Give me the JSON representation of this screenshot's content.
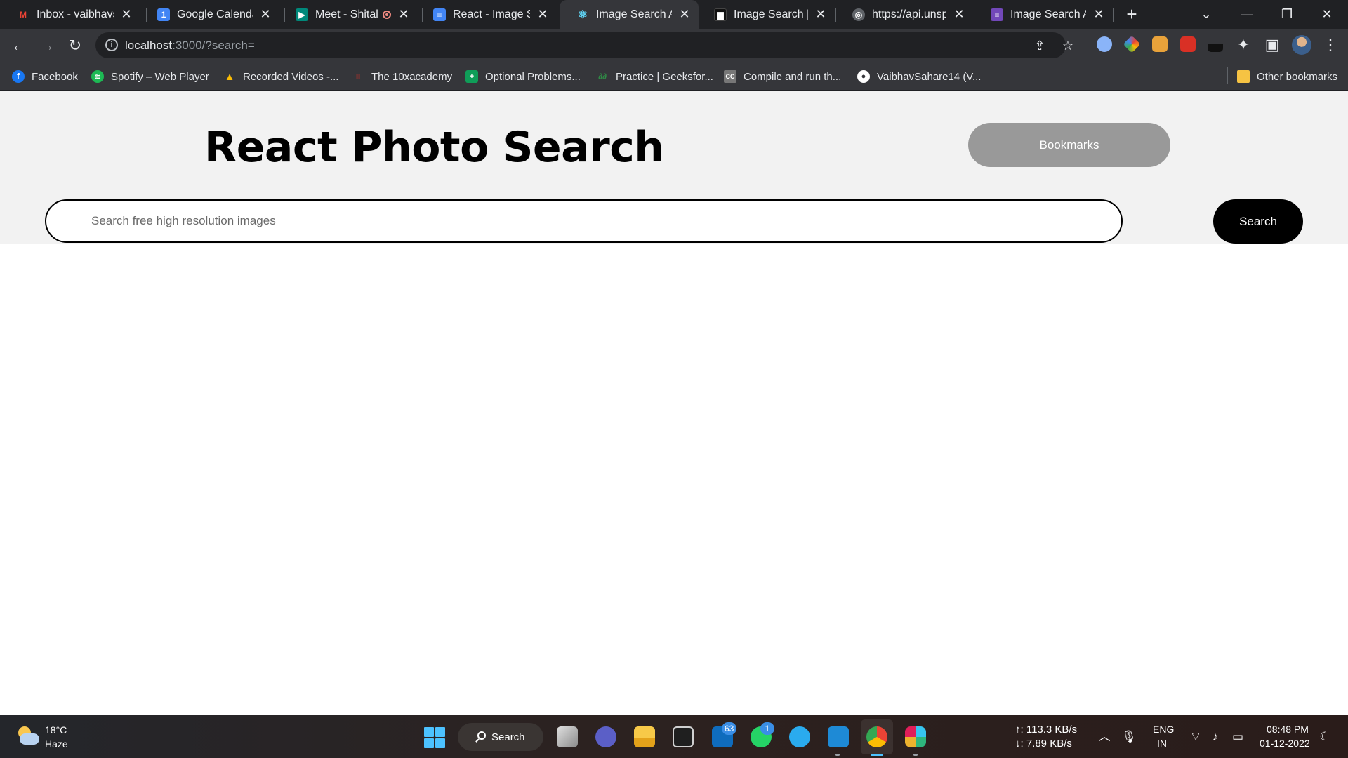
{
  "browser": {
    "tabs": [
      {
        "title": "Inbox - vaibhavsa",
        "favicon_color": "#ea4335",
        "favicon_glyph": "M",
        "active": false
      },
      {
        "title": "Google Calendar",
        "favicon_color": "#4285f4",
        "favicon_glyph": "1",
        "active": false
      },
      {
        "title": "Meet - Shital",
        "favicon_color": "#00897b",
        "favicon_glyph": "▶",
        "active": false,
        "recording": true
      },
      {
        "title": "React - Image Sea",
        "favicon_color": "#4285f4",
        "favicon_glyph": "≡",
        "active": false
      },
      {
        "title": "Image Search Ap",
        "favicon_color": "#61dafb",
        "favicon_glyph": "⚛",
        "active": true
      },
      {
        "title": "Image Search | U",
        "favicon_color": "#111111",
        "favicon_glyph": "▆",
        "active": false
      },
      {
        "title": "https://api.unspla",
        "favicon_color": "#5f6368",
        "favicon_glyph": "◎",
        "active": false
      },
      {
        "title": "Image Search Ap",
        "favicon_color": "#7248b9",
        "favicon_glyph": "≡",
        "active": false
      }
    ],
    "address": {
      "host": "localhost",
      "rest": ":3000/?search="
    },
    "bookmarks": [
      {
        "label": "Facebook",
        "color": "#1877f2",
        "glyph": "f"
      },
      {
        "label": "Spotify – Web Player",
        "color": "#1db954",
        "glyph": "≋"
      },
      {
        "label": "Recorded Videos -...",
        "color": "#fbbc04",
        "glyph": "▲"
      },
      {
        "label": "The 10xacademy",
        "color": "#d93025",
        "glyph": "ıı"
      },
      {
        "label": "Optional Problems...",
        "color": "#0f9d58",
        "glyph": "+"
      },
      {
        "label": "Practice | Geeksfor...",
        "color": "#2f8d46",
        "glyph": "∂∂"
      },
      {
        "label": "Compile and run th...",
        "color": "#777777",
        "glyph": "CC"
      },
      {
        "label": "VaibhavSahare14 (V...",
        "color": "#ffffff",
        "glyph": "●"
      }
    ],
    "other_bookmarks": "Other bookmarks",
    "icons": {
      "back": "arrow-left-icon",
      "forward": "arrow-right-icon",
      "reload": "reload-icon",
      "share": "share-icon",
      "star": "star-icon",
      "extensions": "puzzle-icon",
      "sidepanel": "side-panel-icon"
    }
  },
  "app": {
    "title": "React Photo Search",
    "bookmarks_button": "Bookmarks",
    "search_placeholder": "Search free high resolution images",
    "search_value": "",
    "search_button": "Search",
    "colors": {
      "header_bg": "#f2f2f2",
      "bookmarks_btn": "#999999",
      "search_btn": "#000000"
    }
  },
  "taskbar": {
    "weather": {
      "temp": "18°C",
      "condition": "Haze"
    },
    "search_label": "Search",
    "apps": [
      "file-explorer",
      "teams",
      "folder",
      "notion",
      "outlook",
      "whatsapp",
      "telegram",
      "vscode",
      "chrome",
      "slack"
    ],
    "badges": {
      "outlook": "63",
      "whatsapp": "1"
    },
    "net_up": "↑: 113.3 KB/s",
    "net_down": "↓: 7.89 KB/s",
    "lang": "ENG",
    "region": "IN",
    "time": "08:48 PM",
    "date": "01-12-2022"
  }
}
